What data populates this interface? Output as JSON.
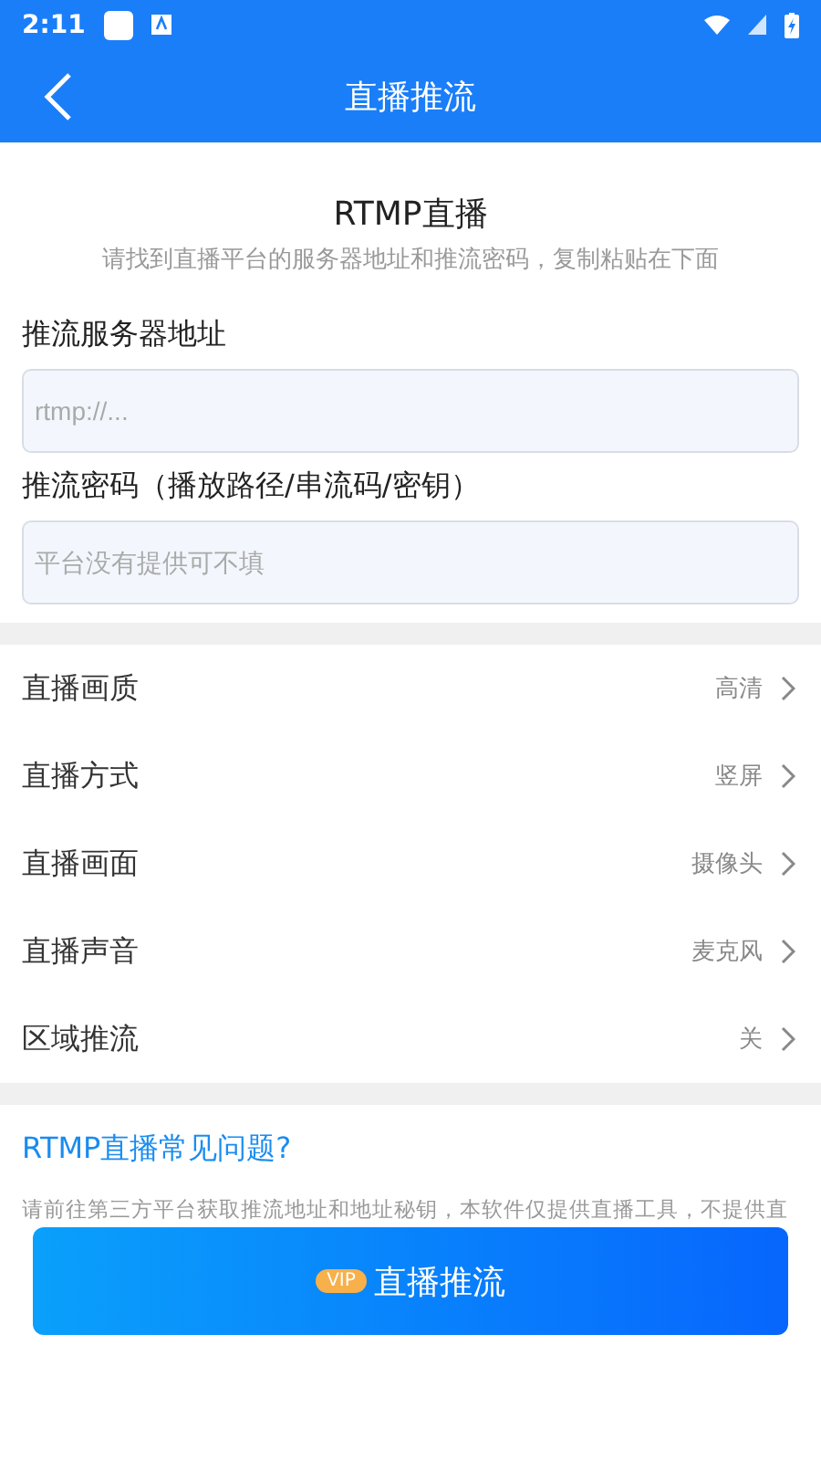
{
  "status_bar": {
    "time": "2:11"
  },
  "header": {
    "title": "直播推流"
  },
  "intro": {
    "title": "RTMP直播",
    "subtitle": "请找到直播平台的服务器地址和推流密码，复制粘贴在下面"
  },
  "fields": [
    {
      "label": "推流服务器地址",
      "placeholder": "rtmp://..."
    },
    {
      "label": "推流密码（播放路径/串流码/密钥）",
      "placeholder": "平台没有提供可不填"
    }
  ],
  "settings": [
    {
      "label": "直播画质",
      "value": "高清"
    },
    {
      "label": "直播方式",
      "value": "竖屏"
    },
    {
      "label": "直播画面",
      "value": "摄像头"
    },
    {
      "label": "直播声音",
      "value": "麦克风"
    },
    {
      "label": "区域推流",
      "value": "关"
    }
  ],
  "faq": {
    "title": "RTMP直播常见问题?",
    "text": "请前往第三方平台获取推流地址和地址秘钥，本软件仅提供直播工具，不提供直"
  },
  "action": {
    "badge": "VIP",
    "label": "直播推流"
  }
}
